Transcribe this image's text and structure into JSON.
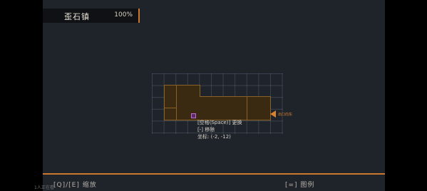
{
  "header": {
    "location_name": "歪石镇",
    "explore_percent": "100%"
  },
  "map": {
    "exit_label": "出口向东",
    "tooltip": {
      "line1": "[空格(Space)] 更换",
      "line2": "[-] 移除",
      "line3": "坐标: (-2, -12)"
    }
  },
  "footer": {
    "zoom_hint": "[Q]/[E] 缩放",
    "legend_hint": "[=] 图例",
    "corner_text": "1人正在看"
  },
  "colors": {
    "accent": "#c9782d",
    "room_fill": "#3a2a12",
    "room_border": "#8a6228",
    "player_marker": "#c66bd6"
  }
}
